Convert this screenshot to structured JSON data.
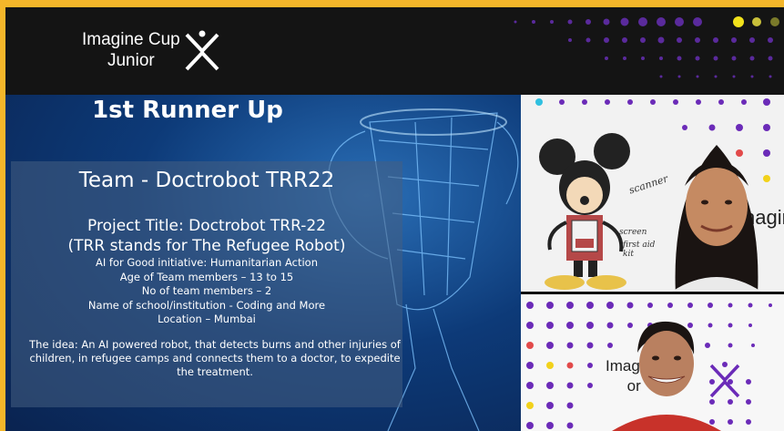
{
  "header": {
    "logo_line1": "Imagine Cup",
    "logo_line2": "Junior",
    "bg_color": "#141414"
  },
  "slide": {
    "title": "1st Runner Up",
    "team": "Team - Doctrobot TRR22",
    "project_line1": "Project Title: Doctrobot TRR-22",
    "project_line2": "(TRR stands for The Refugee Robot)",
    "facts": [
      "AI for Good initiative: Humanitarian Action",
      "Age of Team members – 13 to 15",
      "No of team members – 2",
      "Name of school/institution - Coding and More",
      "Location – Mumbai"
    ],
    "idea": "The idea: An AI powered robot, that detects burns and other injuries of children, in refugee camps and connects them to a doctor, to expedite the treatment."
  },
  "video1": {
    "bg_text": "nagin",
    "drawing_labels": [
      "scanner",
      "screen",
      "first aid kit"
    ]
  },
  "video2": {
    "bg_text_line1": "Imag     o",
    "bg_text_line2": "     or"
  },
  "colors": {
    "border": "#f4b62a",
    "accent_purple": "#6b2bb8",
    "accent_yellow": "#f2d21b"
  }
}
